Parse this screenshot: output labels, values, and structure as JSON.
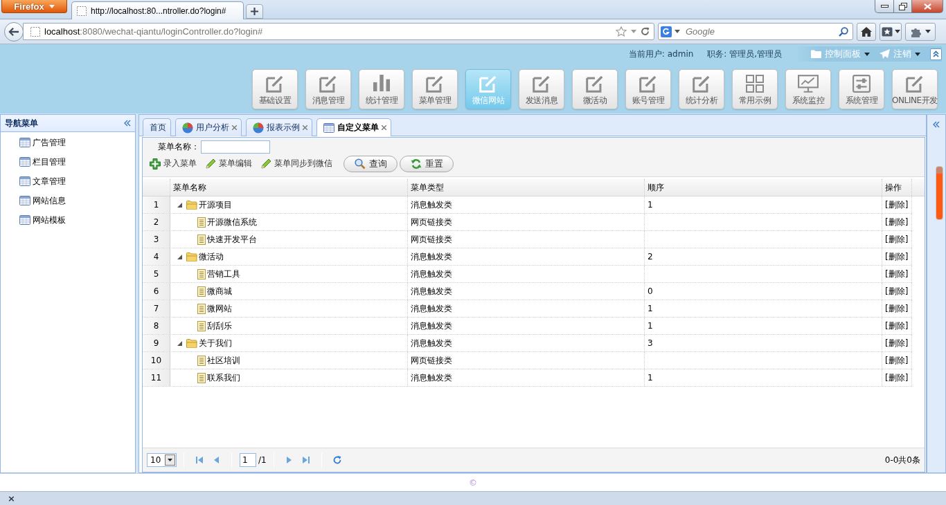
{
  "browser": {
    "menu_button": "Firefox",
    "tab_title": "http://localhost:80...ntroller.do?login#",
    "url": {
      "host": "localhost",
      "path": ":8080/wechat-qiantu/loginController.do?login#"
    },
    "search_placeholder": "Google"
  },
  "header": {
    "current_user": "当前用户: admin",
    "role": "职务: 管理员,管理员",
    "control_panel": "控制面板",
    "logout": "注销"
  },
  "modules": [
    {
      "label": "基础设置",
      "kind": "edit",
      "selected": false
    },
    {
      "label": "消息管理",
      "kind": "edit",
      "selected": false
    },
    {
      "label": "统计管理",
      "kind": "chart",
      "selected": false
    },
    {
      "label": "菜单管理",
      "kind": "edit",
      "selected": false
    },
    {
      "label": "微信网站",
      "kind": "edit",
      "selected": true
    },
    {
      "label": "发送消息",
      "kind": "edit",
      "selected": false
    },
    {
      "label": "微活动",
      "kind": "edit",
      "selected": false
    },
    {
      "label": "账号管理",
      "kind": "edit",
      "selected": false
    },
    {
      "label": "统计分析",
      "kind": "edit",
      "selected": false
    },
    {
      "label": "常用示例",
      "kind": "grid",
      "selected": false
    },
    {
      "label": "系统监控",
      "kind": "monitor",
      "selected": false
    },
    {
      "label": "系统管理",
      "kind": "settings",
      "selected": false
    },
    {
      "label": "ONLINE开发",
      "kind": "edit",
      "selected": false
    }
  ],
  "sidebar": {
    "title": "导航菜单",
    "items": [
      "广告管理",
      "栏目管理",
      "文章管理",
      "网站信息",
      "网站模板"
    ]
  },
  "tabs": [
    {
      "label": "首页",
      "kind": "plain",
      "selected": false,
      "closable": false
    },
    {
      "label": "用户分析",
      "kind": "chart",
      "selected": false,
      "closable": true
    },
    {
      "label": "报表示例",
      "kind": "chart",
      "selected": false,
      "closable": true
    },
    {
      "label": "自定义菜单",
      "kind": "table",
      "selected": true,
      "closable": true
    }
  ],
  "search_form": {
    "label": "菜单名称："
  },
  "toolbar": [
    {
      "label": "录入菜单",
      "kind": "add"
    },
    {
      "label": "菜单编辑",
      "kind": "edit"
    },
    {
      "label": "菜单同步到微信",
      "kind": "edit"
    }
  ],
  "actions": [
    {
      "label": "查询",
      "kind": "search"
    },
    {
      "label": "重置",
      "kind": "reload"
    }
  ],
  "table": {
    "columns": [
      "菜单名称",
      "菜单类型",
      "顺序",
      "操作"
    ],
    "rows": [
      {
        "number": "1",
        "name": "开源项目",
        "type": "消息触发类",
        "order": "1",
        "action": "[删除]",
        "expanded": true,
        "children": [
          {
            "number": "2",
            "name": "开源微信系统",
            "type": "网页链接类",
            "action": "[删除]"
          },
          {
            "number": "3",
            "name": "快速开发平台",
            "type": "网页链接类",
            "action": "[删除]"
          }
        ]
      },
      {
        "number": "4",
        "name": "微活动",
        "type": "消息触发类",
        "order": "2",
        "action": "[删除]",
        "expanded": true,
        "children": [
          {
            "number": "5",
            "name": "营销工具",
            "type": "消息触发类",
            "action": "[删除]"
          },
          {
            "number": "6",
            "name": "微商城",
            "type": "消息触发类",
            "order": "0",
            "action": "[删除]"
          },
          {
            "number": "7",
            "name": "微网站",
            "type": "消息触发类",
            "order": "1",
            "action": "[删除]"
          },
          {
            "number": "8",
            "name": "刮刮乐",
            "type": "消息触发类",
            "order": "1",
            "action": "[删除]"
          }
        ]
      },
      {
        "number": "9",
        "name": "关于我们",
        "type": "消息触发类",
        "order": "3",
        "action": "[删除]",
        "expanded": true,
        "children": [
          {
            "number": "10",
            "name": "社区培训",
            "type": "网页链接类",
            "action": "[删除]"
          },
          {
            "number": "11",
            "name": "联系我们",
            "type": "消息触发类",
            "order": "1",
            "action": "[删除]"
          }
        ]
      }
    ]
  },
  "pager": {
    "page_size": "10",
    "page": "1",
    "page_count": "/1",
    "summary": "0-0共0条"
  },
  "footer": {
    "text": "©"
  },
  "addon_bar": {
    "close": "×"
  }
}
